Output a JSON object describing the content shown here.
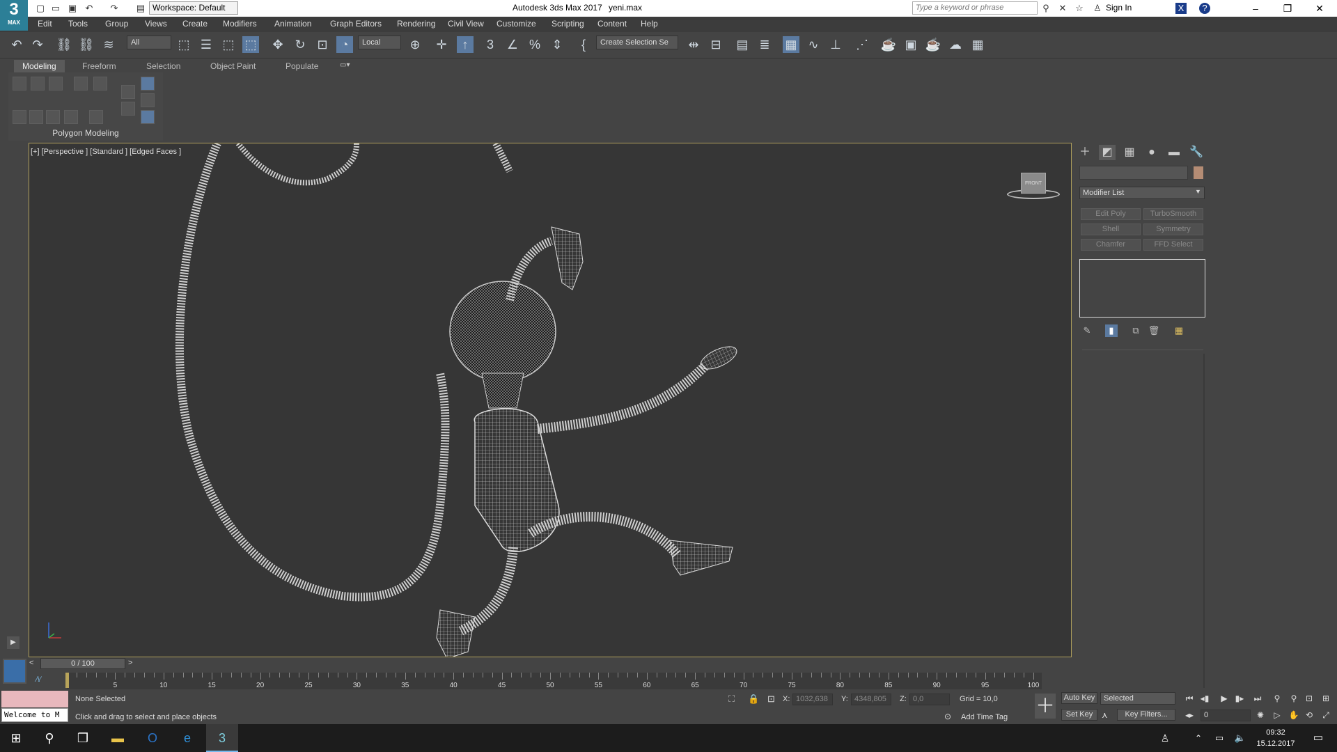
{
  "app": {
    "logo_text": "3",
    "logo_sub": "MAX",
    "title": "Autodesk 3ds Max 2017",
    "file": "yeni.max",
    "workspace": "Workspace: Default",
    "search_placeholder": "Type a keyword or phrase",
    "signin": "Sign In"
  },
  "menu": [
    "Edit",
    "Tools",
    "Group",
    "Views",
    "Create",
    "Modifiers",
    "Animation",
    "Graph Editors",
    "Rendering",
    "Civil View",
    "Customize",
    "Scripting",
    "Content",
    "Help"
  ],
  "toolbar": {
    "filter": "All",
    "coord_system": "Local",
    "selection_set": "Create Selection Se"
  },
  "ribbon": {
    "tabs": [
      "Modeling",
      "Freeform",
      "Selection",
      "Object Paint",
      "Populate"
    ],
    "active_tab": "Modeling",
    "panel_label": "Polygon Modeling"
  },
  "viewport": {
    "label": "[+] [Perspective ] [Standard ] [Edged Faces ]",
    "viewcube_label": "FRONT"
  },
  "command_panel": {
    "modifier_list": "Modifier List",
    "modifier_buttons": [
      "Edit Poly",
      "TurboSmooth",
      "Shell",
      "Symmetry",
      "Chamfer",
      "FFD Select"
    ],
    "object_color": "#b48c74"
  },
  "timeline": {
    "slider": "0 / 100",
    "tick_labels": [
      "5",
      "10",
      "15",
      "20",
      "25",
      "30",
      "35",
      "40",
      "45",
      "50",
      "55",
      "60",
      "65",
      "70",
      "75",
      "80",
      "85",
      "90",
      "95",
      "100"
    ]
  },
  "status": {
    "maxscript_welcome": "Welcome to M",
    "selection": "None Selected",
    "prompt": "Click and drag to select and place objects",
    "x_label": "X:",
    "x_value": "1032,638",
    "y_label": "Y:",
    "y_value": "4348,805",
    "z_label": "Z:",
    "z_value": "0,0",
    "grid": "Grid = 10,0",
    "add_time_tag": "Add Time Tag",
    "auto_key": "Auto Key",
    "set_key": "Set Key",
    "selected_dd": "Selected",
    "key_filters": "Key Filters...",
    "frame": "0"
  },
  "taskbar": {
    "time": "09:32",
    "date": "15.12.2017"
  }
}
